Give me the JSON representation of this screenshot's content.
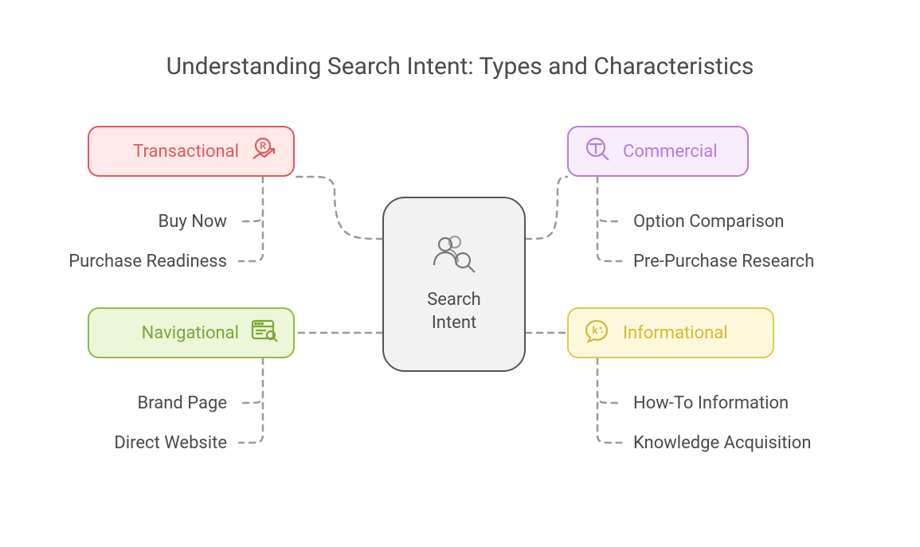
{
  "title": "Understanding Search Intent: Types and Characteristics",
  "center": {
    "label": "Search\nIntent"
  },
  "categories": {
    "transactional": {
      "label": "Transactional",
      "subs": [
        "Buy Now",
        "Purchase Readiness"
      ]
    },
    "navigational": {
      "label": "Navigational",
      "subs": [
        "Brand Page",
        "Direct Website"
      ]
    },
    "commercial": {
      "label": "Commercial",
      "subs": [
        "Option Comparison",
        "Pre-Purchase Research"
      ]
    },
    "informational": {
      "label": "Informational",
      "subs": [
        "How-To Information",
        "Knowledge Acquisition"
      ]
    }
  },
  "colors": {
    "transactional": "#e05a5a",
    "navigational": "#8bbf3f",
    "commercial": "#b97ae0",
    "informational": "#e0cc4d",
    "connector": "#9a9a9a"
  }
}
